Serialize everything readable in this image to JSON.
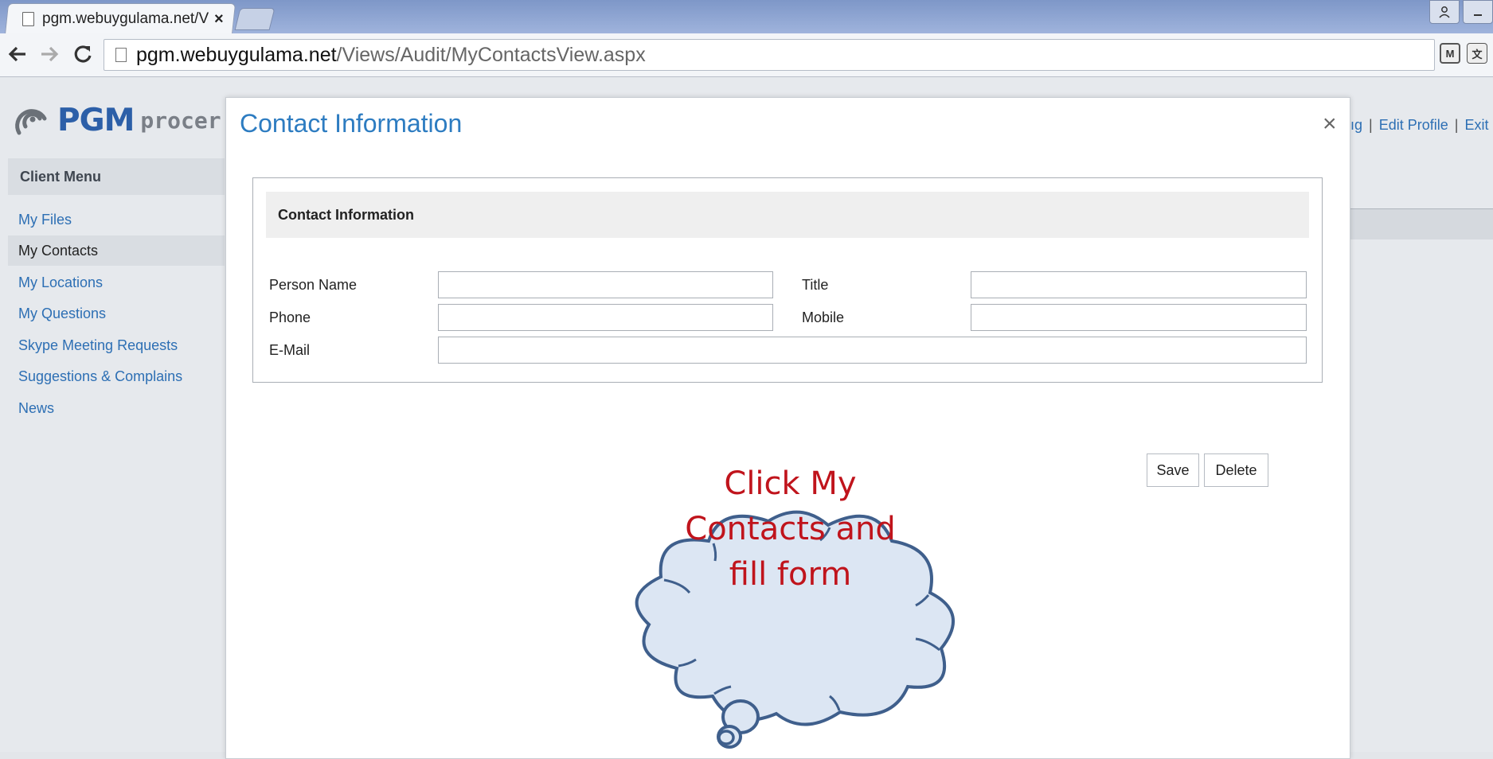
{
  "browser": {
    "tab_title": "pgm.webuygulama.net/Vi",
    "tab_close": "×",
    "url_host": "pgm.webuygulama.net",
    "url_path": "/Views/Audit/MyContactsView.aspx"
  },
  "logo": {
    "brand": "PGM",
    "suffix": "procer"
  },
  "sidebar": {
    "header": "Client Menu",
    "items": [
      {
        "label": "My Files"
      },
      {
        "label": "My Contacts"
      },
      {
        "label": "My Locations"
      },
      {
        "label": "My Questions"
      },
      {
        "label": "Skype Meeting Requests"
      },
      {
        "label": "Suggestions & Complains"
      },
      {
        "label": "News"
      }
    ],
    "active_item": "My Contacts"
  },
  "top_links": {
    "partial": "ıg",
    "edit_profile": "Edit Profile",
    "exit": "Exit",
    "separator": "|"
  },
  "modal": {
    "title": "Contact Information",
    "close": "×",
    "panel_title": "Contact Information",
    "fields": {
      "person_name": {
        "label": "Person Name",
        "value": ""
      },
      "title": {
        "label": "Title",
        "value": ""
      },
      "phone": {
        "label": "Phone",
        "value": ""
      },
      "mobile": {
        "label": "Mobile",
        "value": ""
      },
      "email": {
        "label": "E-Mail",
        "value": ""
      }
    },
    "buttons": {
      "save": "Save",
      "delete": "Delete"
    }
  },
  "callout": {
    "line1": "Click My",
    "line2": "Contacts and",
    "line3": "fill form"
  },
  "colors": {
    "link": "#2d6fb4",
    "modal_title": "#2d7cc1",
    "callout_text": "#c0141c",
    "callout_fill": "#dce6f3",
    "callout_stroke": "#3f5f8c"
  }
}
